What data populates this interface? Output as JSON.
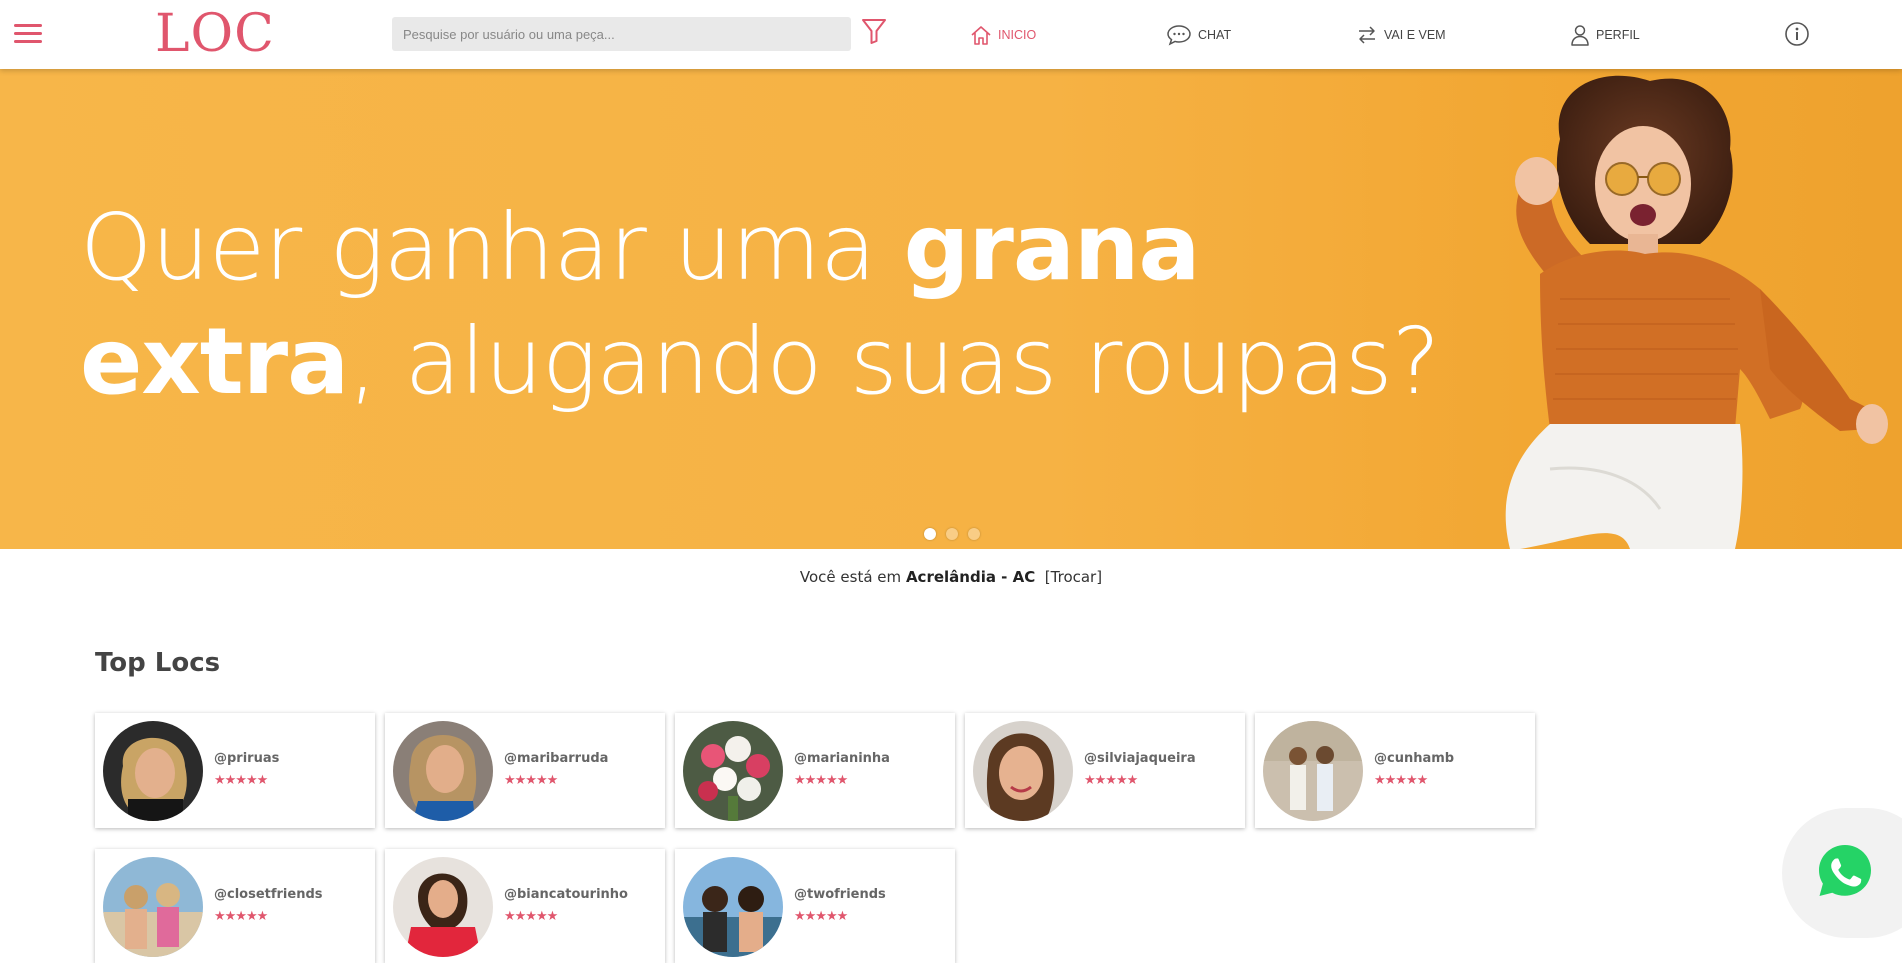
{
  "header": {
    "logo": "LOC",
    "search_placeholder": "Pesquise por usuário ou uma peça...",
    "nav": [
      {
        "label": "INICIO",
        "icon": "home-icon",
        "active": true
      },
      {
        "label": "CHAT",
        "icon": "chat-bubble-icon",
        "active": false
      },
      {
        "label": "VAI E VEM",
        "icon": "swap-arrows-icon",
        "active": false
      },
      {
        "label": "PERFIL",
        "icon": "user-icon",
        "active": false
      }
    ]
  },
  "banner": {
    "line1_regular": "Quer ganhar uma ",
    "line1_bold": "grana",
    "line2_bold": "extra",
    "line2_regular": ", alugando suas roupas?",
    "slides": 3,
    "active_slide": 1
  },
  "location": {
    "prefix": "Você está em",
    "city": "Acrelândia - AC",
    "change": "[Trocar]"
  },
  "top_locs": {
    "title": "Top Locs",
    "users": [
      {
        "handle": "@priruas",
        "stars": "★★★★★"
      },
      {
        "handle": "@maribarruda",
        "stars": "★★★★★"
      },
      {
        "handle": "@marianinha",
        "stars": "★★★★★"
      },
      {
        "handle": "@silviajaqueira",
        "stars": "★★★★★"
      },
      {
        "handle": "@cunhamb",
        "stars": "★★★★★"
      },
      {
        "handle": "@closetfriends",
        "stars": "★★★★★"
      },
      {
        "handle": "@biancatourinho",
        "stars": "★★★★★"
      },
      {
        "handle": "@twofriends",
        "stars": "★★★★★"
      }
    ]
  },
  "colors": {
    "brand": "#e0566d",
    "banner": "#f6b244",
    "whatsapp": "#25d366"
  }
}
